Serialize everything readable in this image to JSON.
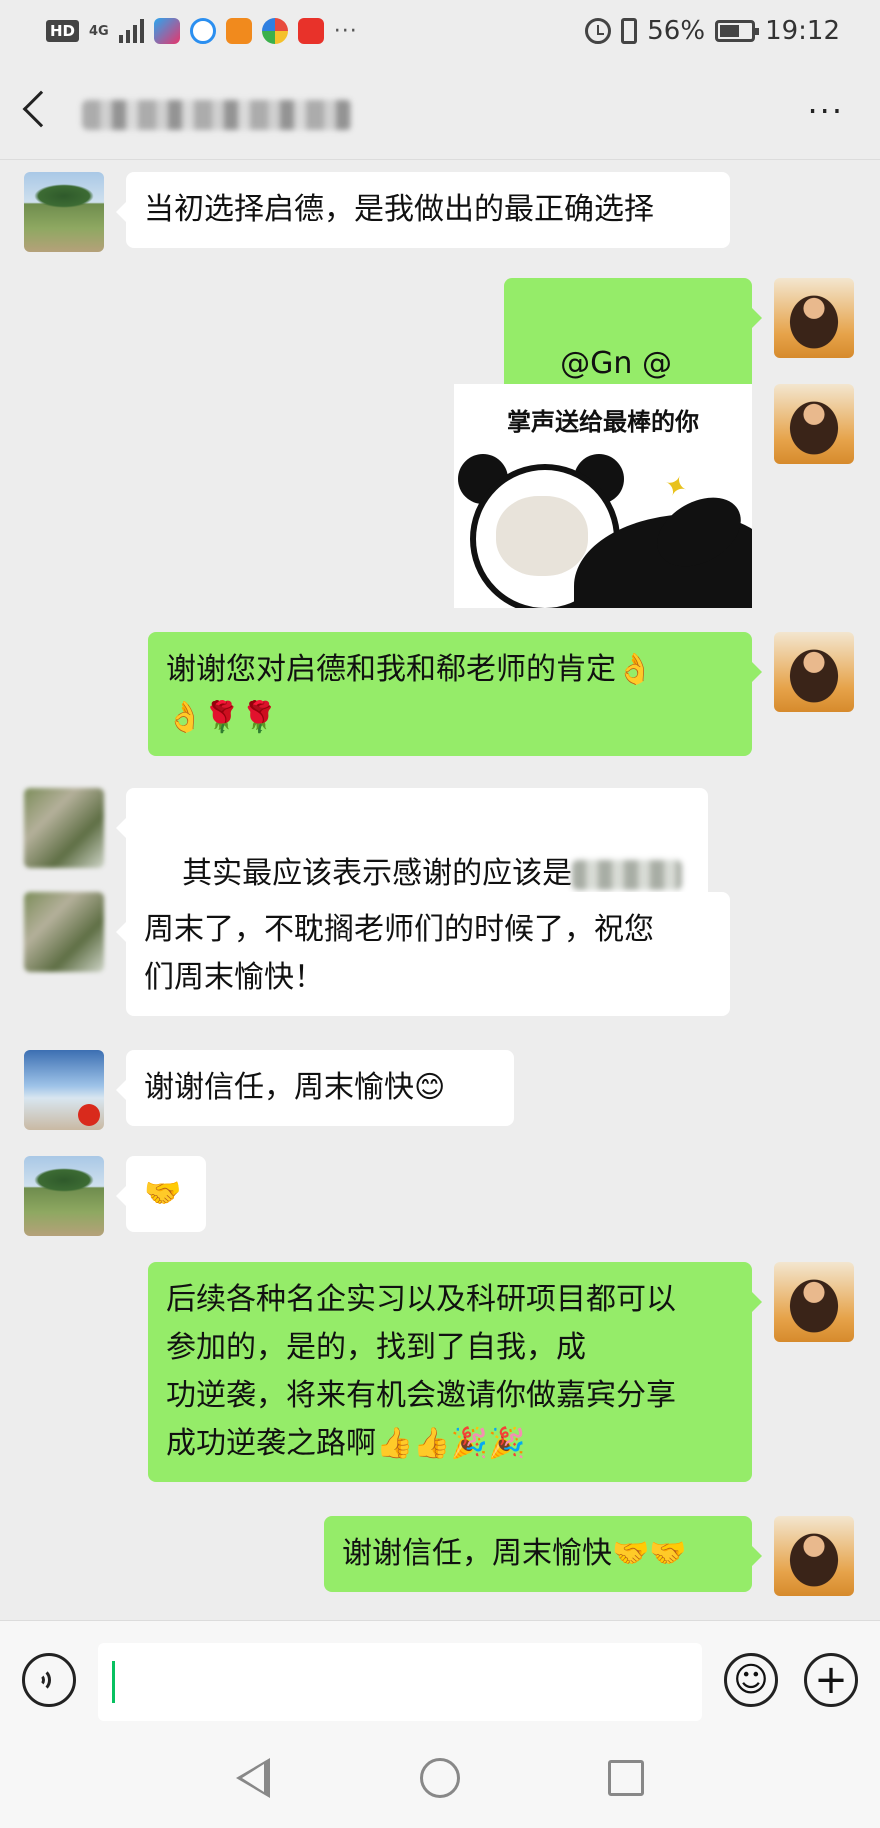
{
  "status_bar": {
    "network": "4G",
    "hd_label": "HD",
    "overflow": "···",
    "battery_percent": "56%",
    "time": "19:12",
    "battery_level": 0.56
  },
  "header": {
    "back_icon": "chevron-left-icon",
    "more": "···"
  },
  "messages": [
    {
      "side": "left",
      "text": "当初选择启德，是我做出的最正确选择"
    },
    {
      "side": "right",
      "text": "@Gn @"
    },
    {
      "side": "right",
      "type": "sticker",
      "caption": "掌声送给最棒的你"
    },
    {
      "side": "right",
      "text": "谢谢您对启德和我和郗老师的肯定👌\n👌🌹🌹"
    },
    {
      "side": "left",
      "text": "其实最应该表示感谢的应该是"
    },
    {
      "side": "left",
      "text": "周末了，不耽搁老师们的时候了，祝您\n们周末愉快！"
    },
    {
      "side": "left",
      "text": "谢谢信任，周末愉快😊"
    },
    {
      "side": "left",
      "text": "🤝"
    },
    {
      "side": "right",
      "text": "后续各种名企实习以及科研项目都可以\n参加的，是的，找到了自我，成\n功逆袭，将来有机会邀请你做嘉宾分享\n成功逆袭之路啊👍👍🎉🎉"
    },
    {
      "side": "right",
      "text": "谢谢信任，周末愉快🤝🤝"
    }
  ],
  "input_bar": {
    "voice_icon": "voice-icon",
    "emoji_icon": "emoji-icon",
    "plus_icon": "plus-icon",
    "plus": "+",
    "smiley": "☺"
  },
  "nav_bar": {
    "back": "back-triangle-icon",
    "home": "home-circle-icon",
    "recent": "recent-square-icon"
  }
}
